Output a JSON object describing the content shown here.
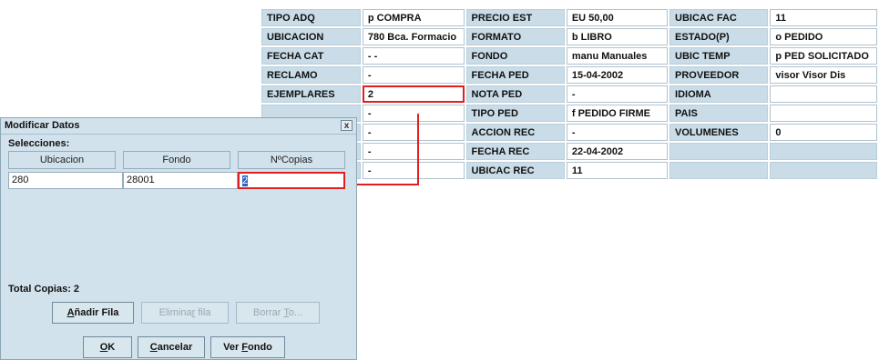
{
  "grid": {
    "rows": [
      [
        {
          "t": "TIPO ADQ",
          "c": "lbl"
        },
        {
          "t": "p COMPRA",
          "c": "val"
        },
        {
          "t": "PRECIO EST",
          "c": "lbl"
        },
        {
          "t": "EU 50,00",
          "c": "val"
        },
        {
          "t": "UBICAC FAC",
          "c": "lbl"
        },
        {
          "t": "11",
          "c": "val"
        }
      ],
      [
        {
          "t": "UBICACION",
          "c": "lbl"
        },
        {
          "t": "780  Bca. Formacio",
          "c": "val"
        },
        {
          "t": "FORMATO",
          "c": "lbl"
        },
        {
          "t": "b LIBRO",
          "c": "val"
        },
        {
          "t": "ESTADO(P)",
          "c": "lbl"
        },
        {
          "t": "o PEDIDO",
          "c": "val"
        }
      ],
      [
        {
          "t": "FECHA CAT",
          "c": "lbl"
        },
        {
          "t": "  - -",
          "c": "val"
        },
        {
          "t": "FONDO",
          "c": "lbl"
        },
        {
          "t": "manu  Manuales",
          "c": "val"
        },
        {
          "t": "UBIC TEMP",
          "c": "lbl"
        },
        {
          "t": "p PED SOLICITADO",
          "c": "val"
        }
      ],
      [
        {
          "t": "RECLAMO",
          "c": "lbl"
        },
        {
          "t": "-",
          "c": "val"
        },
        {
          "t": "FECHA PED",
          "c": "lbl"
        },
        {
          "t": "15-04-2002",
          "c": "val"
        },
        {
          "t": "PROVEEDOR",
          "c": "lbl"
        },
        {
          "t": "visor Visor Dis",
          "c": "val"
        }
      ],
      [
        {
          "t": "EJEMPLARES",
          "c": "lbl"
        },
        {
          "t": "2",
          "c": "val",
          "hl": true
        },
        {
          "t": "NOTA PED",
          "c": "lbl"
        },
        {
          "t": "-",
          "c": "val"
        },
        {
          "t": "IDIOMA",
          "c": "lbl"
        },
        {
          "t": "",
          "c": "val"
        }
      ],
      [
        {
          "t": "",
          "c": "empty"
        },
        {
          "t": "-",
          "c": "val"
        },
        {
          "t": "TIPO PED",
          "c": "lbl"
        },
        {
          "t": "f PEDIDO FIRME",
          "c": "val"
        },
        {
          "t": "PAIS",
          "c": "lbl"
        },
        {
          "t": "",
          "c": "val"
        }
      ],
      [
        {
          "t": "",
          "c": "empty"
        },
        {
          "t": "-",
          "c": "val"
        },
        {
          "t": "ACCION REC",
          "c": "lbl"
        },
        {
          "t": "-",
          "c": "val"
        },
        {
          "t": "VOLUMENES",
          "c": "lbl"
        },
        {
          "t": "0",
          "c": "val"
        }
      ],
      [
        {
          "t": "",
          "c": "empty"
        },
        {
          "t": "-",
          "c": "val"
        },
        {
          "t": "FECHA REC",
          "c": "lbl"
        },
        {
          "t": "22-04-2002",
          "c": "val"
        },
        {
          "t": "",
          "c": "empty"
        },
        {
          "t": "",
          "c": "empty"
        }
      ],
      [
        {
          "t": "",
          "c": "empty"
        },
        {
          "t": "-",
          "c": "val"
        },
        {
          "t": "UBICAC REC",
          "c": "lbl"
        },
        {
          "t": "11",
          "c": "val"
        },
        {
          "t": "",
          "c": "empty"
        },
        {
          "t": "",
          "c": "empty"
        }
      ]
    ]
  },
  "dialog": {
    "title": "Modificar Datos",
    "close_label": "x",
    "selections_label": "Selecciones:",
    "columns": [
      "Ubicacion",
      "Fondo",
      "NºCopias"
    ],
    "row": {
      "ubicacion": "280",
      "fondo": "28001",
      "copias": "2"
    },
    "total_label": "Total Copias: 2",
    "buttons": {
      "add_row": {
        "pre": "",
        "u": "A",
        "post": "ñadir Fila"
      },
      "delete_row": {
        "pre": "Elimina",
        "u": "r",
        "post": " fila"
      },
      "clear_all": {
        "pre": "Borrar ",
        "u": "T",
        "post": "o..."
      },
      "ok": {
        "pre": "",
        "u": "O",
        "post": "K"
      },
      "cancel": {
        "pre": "",
        "u": "C",
        "post": "ancelar"
      },
      "view_fondo": {
        "pre": "Ver ",
        "u": "F",
        "post": "ondo"
      }
    }
  },
  "colors": {
    "highlight": "#e0201f",
    "label_bg": "#c9dce7",
    "dialog_bg": "#d2e2ec",
    "selection": "#2d62c5"
  }
}
